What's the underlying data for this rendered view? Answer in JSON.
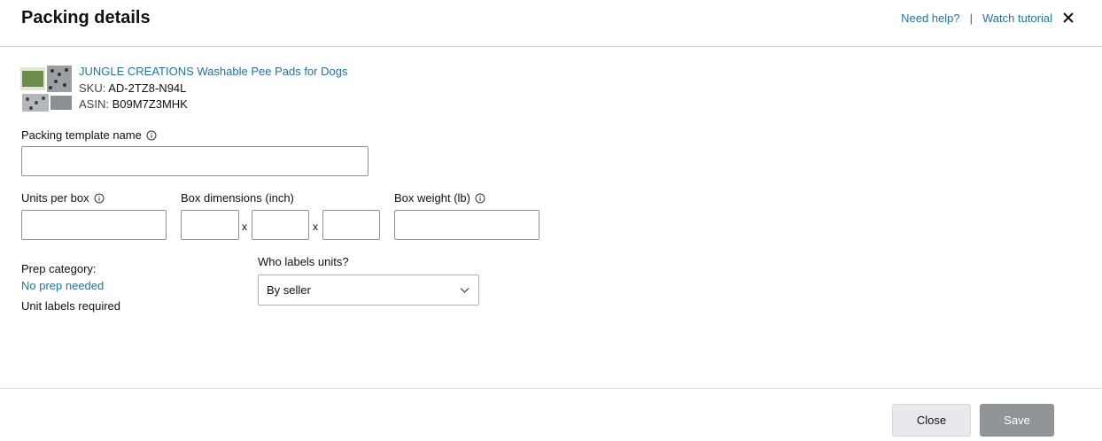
{
  "header": {
    "title": "Packing details",
    "need_help": "Need help?",
    "separator": "|",
    "watch_tutorial": "Watch tutorial"
  },
  "product": {
    "name": "JUNGLE CREATIONS Washable Pee Pads for Dogs",
    "sku_label": "SKU:",
    "sku": "AD-2TZ8-N94L",
    "asin_label": "ASIN:",
    "asin": "B09M7Z3MHK"
  },
  "form": {
    "template_name_label": "Packing template name",
    "template_name_value": "",
    "units_per_box_label": "Units per box",
    "units_per_box_value": "",
    "box_dimensions_label": "Box dimensions (inch)",
    "dim_separator": "x",
    "box_weight_label": "Box weight (lb)",
    "prep_category_label": "Prep category:",
    "prep_category_value": "No prep needed",
    "unit_labels_text": "Unit labels required",
    "who_labels_label": "Who labels units?",
    "who_labels_value": "By seller"
  },
  "footer": {
    "close_label": "Close",
    "save_label": "Save"
  },
  "colors": {
    "link": "#2272a8",
    "save_button_bg": "#8f9597",
    "close_button_bg": "#e7e9ec"
  }
}
